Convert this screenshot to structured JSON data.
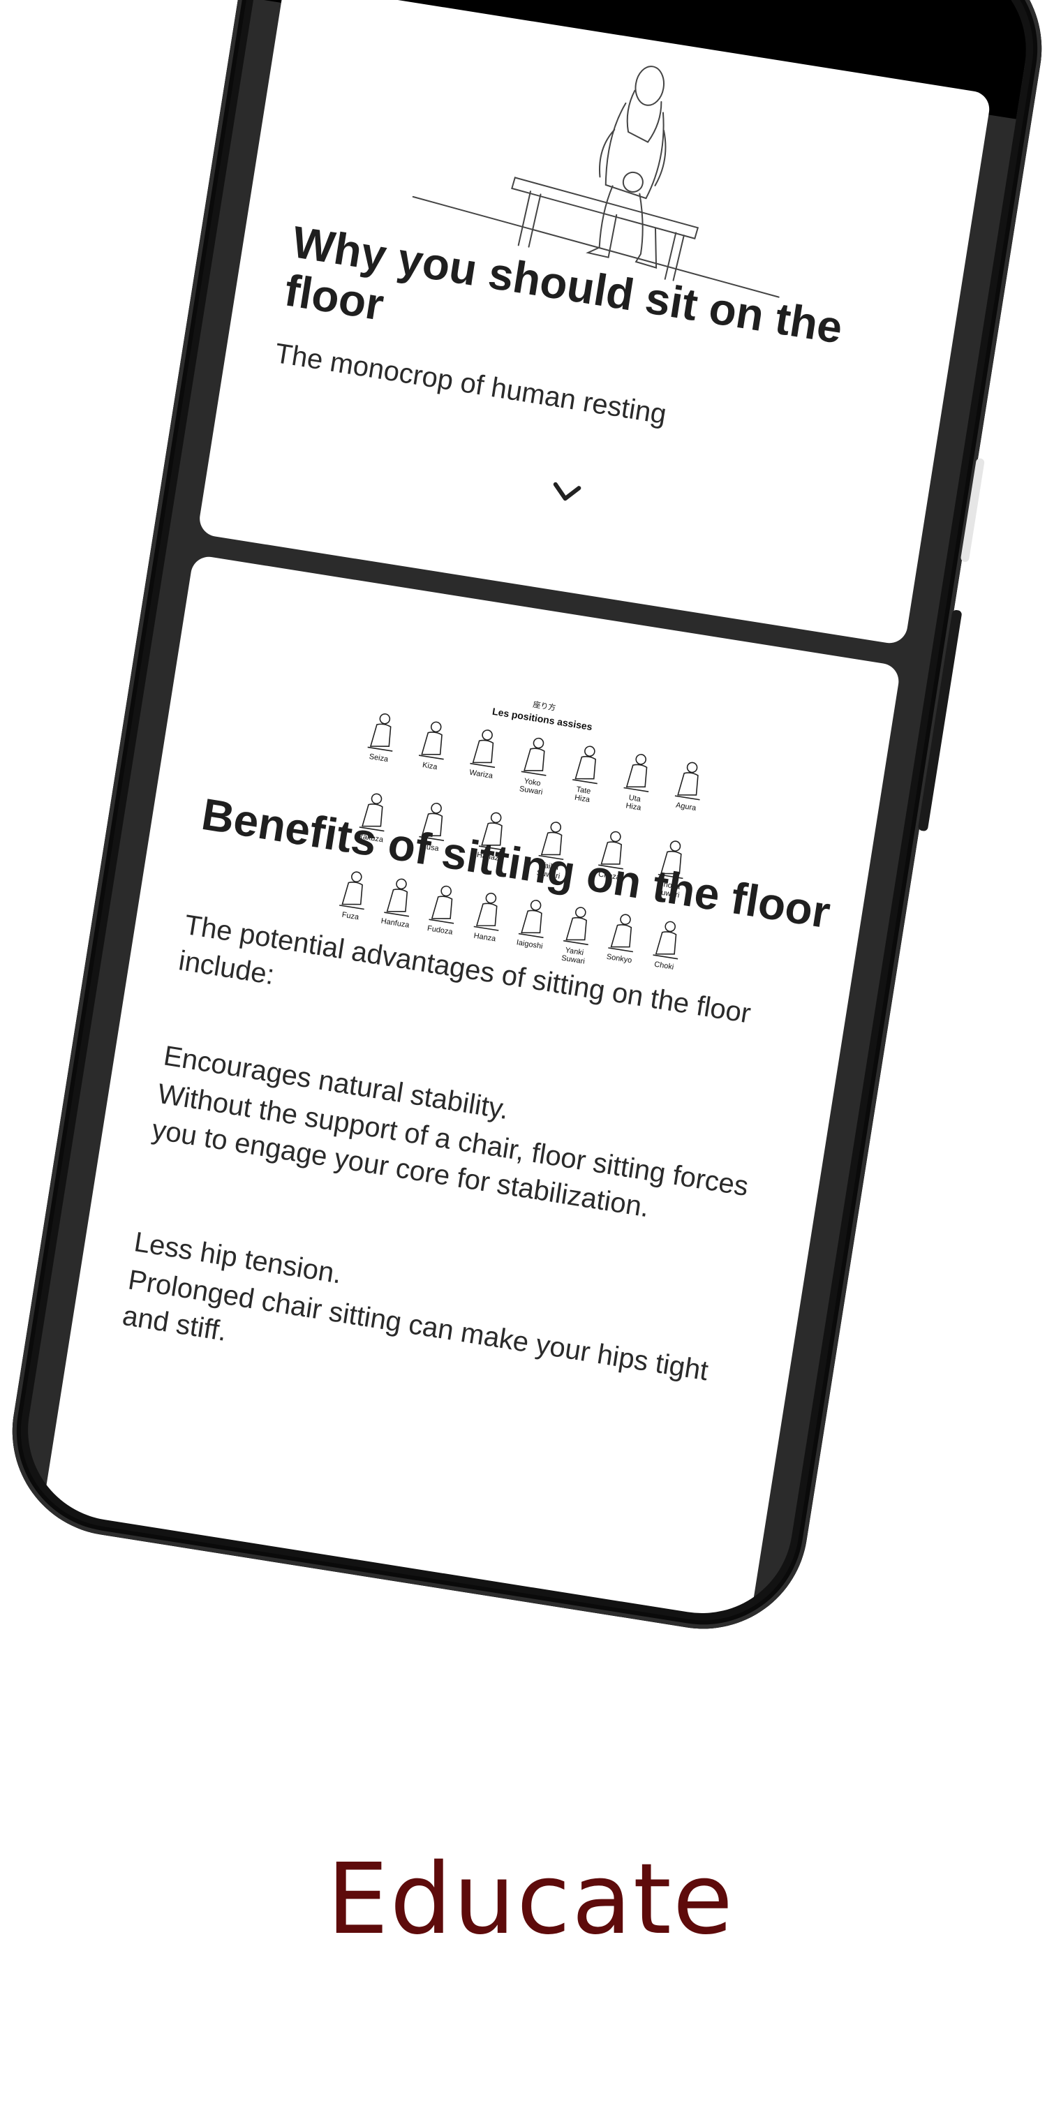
{
  "screen": {
    "back_icon": "chevron-left-icon",
    "cards": [
      {
        "title": "Why you should sit on the floor",
        "subtitle": "The monocrop of human resting",
        "illustration": "person-sitting-on-bench-line-drawing",
        "expand_icon": "chevron-down-icon"
      },
      {
        "title": "Benefits of sitting on the floor",
        "illustration": "sitting-positions-chart",
        "chart_heading_jp": "座り方",
        "chart_heading": "Les positions assises",
        "positions": [
          "Seiza",
          "Kiza",
          "Wariza",
          "Yoko Suwari",
          "Tate Hiza",
          "Uta Hiza",
          "Agura",
          "Rakuza",
          "Kusa",
          "Hanaza",
          "Taiku Suwari",
          "Choza",
          "Choza Suwari",
          "Fuza",
          "Hanfuza",
          "Fudoza",
          "Hanza",
          "Iaigoshi",
          "Yanki Suwari",
          "Sonkyo",
          "Choki"
        ],
        "intro": "The potential advantages of sitting on the floor include:",
        "benefits": [
          {
            "title": "Encourages natural stability.",
            "text": "Without the support of a chair, floor sitting forces you to engage your core for stabilization."
          },
          {
            "title": "Less hip tension.",
            "text": "Prolonged chair sitting can make your hips tight and stiff."
          }
        ]
      }
    ]
  },
  "caption": "Educate",
  "colors": {
    "caption": "#5e0b0b",
    "phone_frame": "#121212",
    "screen_bg": "#2b2b2b",
    "card_bg": "#ffffff"
  }
}
